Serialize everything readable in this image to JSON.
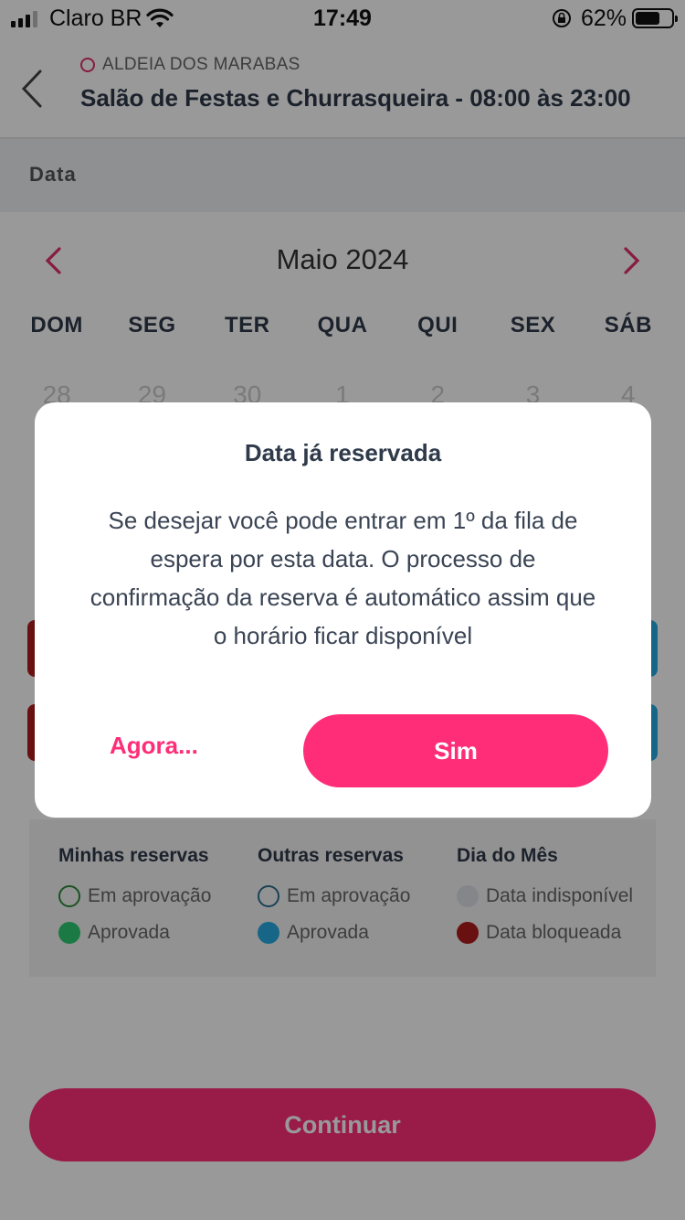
{
  "status_bar": {
    "carrier": "Claro BR",
    "time": "17:49",
    "battery": "62%"
  },
  "header": {
    "building": "ALDEIA DOS MARABAS",
    "title": "Salão de Festas e Churrasqueira - 08:00 às 23:00"
  },
  "section": {
    "label": "Data"
  },
  "calendar": {
    "month": "Maio 2024",
    "weekdays": [
      "DOM",
      "SEG",
      "TER",
      "QUA",
      "QUI",
      "SEX",
      "SÁB"
    ],
    "first_row": [
      "28",
      "29",
      "30",
      "1",
      "2",
      "3",
      "4"
    ]
  },
  "legend": {
    "col1": {
      "title": "Minhas reservas",
      "items": [
        "Em aprovação",
        "Aprovada"
      ]
    },
    "col2": {
      "title": "Outras reservas",
      "items": [
        "Em aprovação",
        "Aprovada"
      ]
    },
    "col3": {
      "title": "Dia do Mês",
      "items": [
        "Data indisponível",
        "Data bloqueada"
      ]
    }
  },
  "continue_label": "Continuar",
  "modal": {
    "title": "Data já reservada",
    "body": "Se desejar você pode entrar em 1º da fila de espera por esta data. O processo de confirmação da reserva é automático assim que o horário ficar disponível",
    "later_label": "Agora...",
    "yes_label": "Sim"
  },
  "colors": {
    "accent": "#ff2d78",
    "text_dark": "#2f3a4a",
    "approved_mine": "#2ecc71",
    "approved_other": "#27a9e1",
    "blocked": "#b01b1b"
  }
}
